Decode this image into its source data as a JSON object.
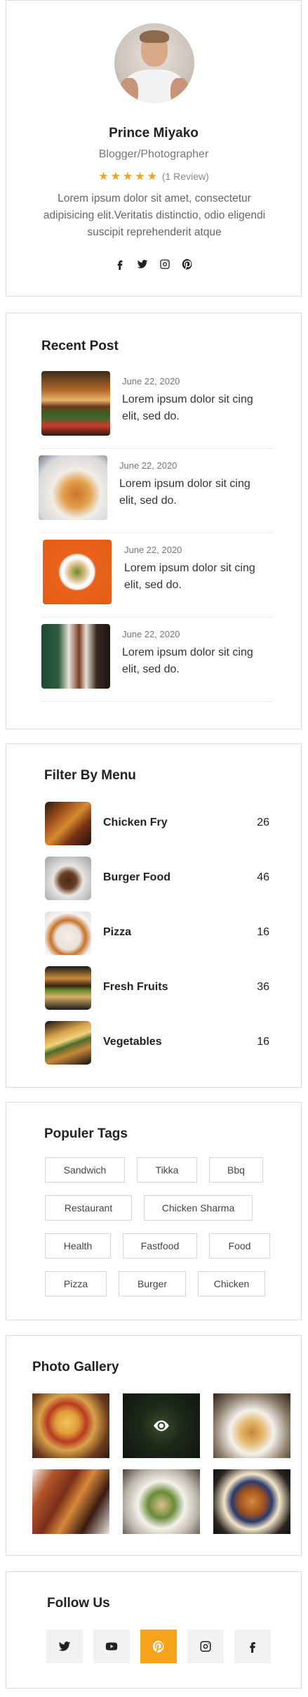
{
  "profile": {
    "name": "Prince Miyako",
    "role": "Blogger/Photographer",
    "stars": "★★★★★",
    "review_count": "(1 Review)",
    "rating_value": 5,
    "bio": "Lorem ipsum dolor sit amet, consectetur adipisicing elit.Veritatis distinctio, odio eligendi suscipit reprehenderit atque",
    "socials": [
      "facebook-icon",
      "twitter-icon",
      "instagram-icon",
      "pinterest-icon"
    ]
  },
  "recent": {
    "title": "Recent Post",
    "posts": [
      {
        "date": "June 22, 2020",
        "text": "Lorem ipsum dolor sit cing elit, sed do."
      },
      {
        "date": "June 22, 2020",
        "text": "Lorem ipsum dolor sit cing elit, sed do."
      },
      {
        "date": "June 22, 2020",
        "text": "Lorem ipsum dolor sit cing elit, sed do."
      },
      {
        "date": "June 22, 2020",
        "text": "Lorem ipsum dolor sit cing elit, sed do."
      }
    ]
  },
  "filter": {
    "title": "Filter By Menu",
    "items": [
      {
        "label": "Chicken Fry",
        "count": "26"
      },
      {
        "label": "Burger Food",
        "count": "46"
      },
      {
        "label": "Pizza",
        "count": "16"
      },
      {
        "label": "Fresh Fruits",
        "count": "36"
      },
      {
        "label": "Vegetables",
        "count": "16"
      }
    ]
  },
  "tags": {
    "title": "Populer Tags",
    "items": [
      "Sandwich",
      "Tikka",
      "Bbq",
      "Restaurant",
      "Chicken Sharma",
      "Health",
      "Fastfood",
      "Food",
      "Pizza",
      "Burger",
      "Chicken"
    ]
  },
  "gallery": {
    "title": "Photo Gallery"
  },
  "follow": {
    "title": "Follow Us",
    "buttons": [
      "twitter-icon",
      "youtube-icon",
      "pinterest-icon",
      "instagram-icon",
      "facebook-icon"
    ],
    "active_color": "#f7a21b"
  },
  "colors": {
    "accent": "#f7a21b",
    "border": "#dcdcdc",
    "muted_text": "#777777"
  }
}
